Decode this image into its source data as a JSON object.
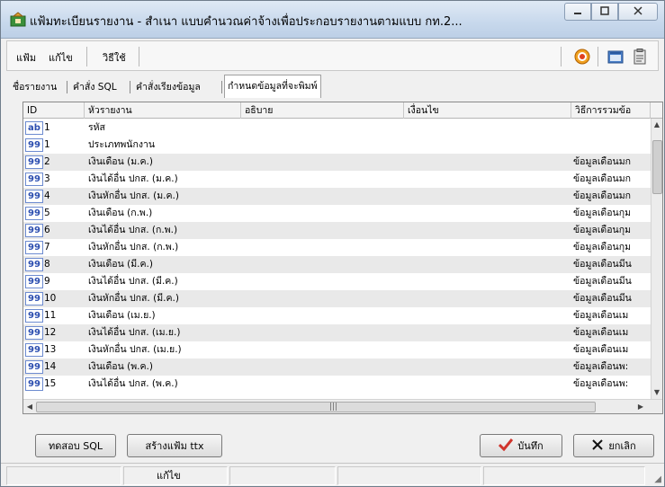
{
  "window": {
    "title": "แฟ้มทะเบียนรายงาน - สำเนา แบบคำนวณค่าจ้างเพื่อประกอบรายงานตามแบบ กท.2...",
    "min_icon": "minimize-icon",
    "max_icon": "maximize-icon",
    "close_icon": "close-icon"
  },
  "menu": {
    "file": "แฟ้ม",
    "edit": "แก้ไข",
    "howto": "วิธีใช้"
  },
  "tabs": [
    {
      "label": "ชื่อรายงาน"
    },
    {
      "label": "คำสั่ง SQL"
    },
    {
      "label": "คำสั่งเรียงข้อมูล"
    },
    {
      "label": "กำหนดข้อมูลที่จะพิมพ์"
    }
  ],
  "grid": {
    "columns": [
      "ID",
      "หัวรายงาน",
      "อธิบาย",
      "เงื่อนไข",
      "วิธีการรวมข้อ"
    ],
    "rows": [
      {
        "type": "ab",
        "id": "1",
        "title": "รหัส",
        "desc": "",
        "cond": "",
        "agg": ""
      },
      {
        "type": "99",
        "id": "1",
        "title": "ประเภทพนักงาน",
        "desc": "",
        "cond": "",
        "agg": ""
      },
      {
        "type": "99",
        "id": "2",
        "title": "เงินเดือน (ม.ค.)",
        "desc": "",
        "cond": "",
        "agg": "ข้อมูลเดือนมก"
      },
      {
        "type": "99",
        "id": "3",
        "title": "เงินได้อื่น ปกส. (ม.ค.)",
        "desc": "",
        "cond": "",
        "agg": "ข้อมูลเดือนมก"
      },
      {
        "type": "99",
        "id": "4",
        "title": "เงินหักอื่น ปกส. (ม.ค.)",
        "desc": "",
        "cond": "",
        "agg": "ข้อมูลเดือนมก"
      },
      {
        "type": "99",
        "id": "5",
        "title": "เงินเดือน (ก.พ.)",
        "desc": "",
        "cond": "",
        "agg": "ข้อมูลเดือนกุม"
      },
      {
        "type": "99",
        "id": "6",
        "title": "เงินได้อื่น ปกส. (ก.พ.)",
        "desc": "",
        "cond": "",
        "agg": "ข้อมูลเดือนกุม"
      },
      {
        "type": "99",
        "id": "7",
        "title": "เงินหักอื่น ปกส. (ก.พ.)",
        "desc": "",
        "cond": "",
        "agg": "ข้อมูลเดือนกุม"
      },
      {
        "type": "99",
        "id": "8",
        "title": "เงินเดือน (มี.ค.)",
        "desc": "",
        "cond": "",
        "agg": "ข้อมูลเดือนมีน"
      },
      {
        "type": "99",
        "id": "9",
        "title": "เงินได้อื่น ปกส. (มี.ค.)",
        "desc": "",
        "cond": "",
        "agg": "ข้อมูลเดือนมีน"
      },
      {
        "type": "99",
        "id": "10",
        "title": "เงินหักอื่น ปกส. (มี.ค.)",
        "desc": "",
        "cond": "",
        "agg": "ข้อมูลเดือนมีน"
      },
      {
        "type": "99",
        "id": "11",
        "title": "เงินเดือน (เม.ย.)",
        "desc": "",
        "cond": "",
        "agg": "ข้อมูลเดือนเม"
      },
      {
        "type": "99",
        "id": "12",
        "title": "เงินได้อื่น ปกส. (เม.ย.)",
        "desc": "",
        "cond": "",
        "agg": "ข้อมูลเดือนเม"
      },
      {
        "type": "99",
        "id": "13",
        "title": "เงินหักอื่น ปกส. (เม.ย.)",
        "desc": "",
        "cond": "",
        "agg": "ข้อมูลเดือนเม"
      },
      {
        "type": "99",
        "id": "14",
        "title": "เงินเดือน (พ.ค.)",
        "desc": "",
        "cond": "",
        "agg": "ข้อมูลเดือนพ:"
      },
      {
        "type": "99",
        "id": "15",
        "title": "เงินได้อื่น ปกส. (พ.ค.)",
        "desc": "",
        "cond": "",
        "agg": "ข้อมูลเดือนพ:"
      }
    ]
  },
  "buttons": {
    "test_sql": "ทดสอบ SQL",
    "create_ttx": "สร้างแฟ้ม ttx",
    "save": "บันทึก",
    "cancel": "ยกเลิก"
  },
  "status": {
    "pane2": "แก้ไข"
  },
  "colors": {
    "row_alt": "#e9e9e9",
    "badge_border": "#6d8bd0",
    "save_check": "#d0342c"
  }
}
